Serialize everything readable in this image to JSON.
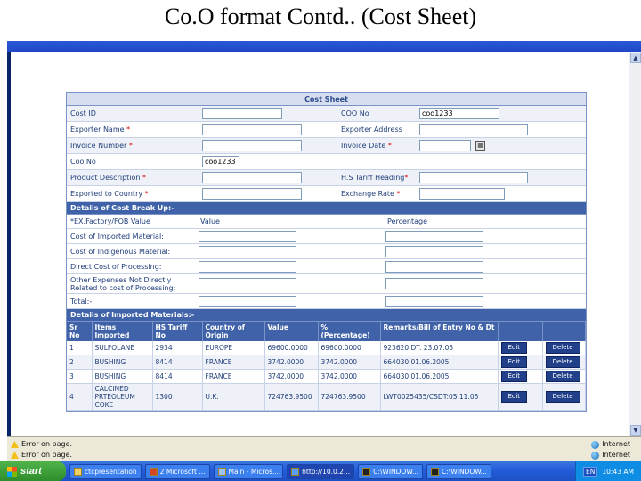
{
  "slide_title": "Co.O format Contd.. (Cost Sheet)",
  "browser": {
    "window_title": "",
    "status_left": "Error on page.",
    "status_zone": "Internet"
  },
  "form": {
    "title": "Cost Sheet",
    "fields": {
      "cost_id": {
        "label": "Cost ID",
        "required": false,
        "value": ""
      },
      "coo_no": {
        "label": "COO No",
        "required": false,
        "value": "coo1233"
      },
      "exporter_name": {
        "label": "Exporter Name",
        "required": true,
        "value": ""
      },
      "exporter_address": {
        "label": "Exporter Address",
        "required": false,
        "value": ""
      },
      "invoice_number": {
        "label": "Invoice Number",
        "required": true,
        "value": ""
      },
      "invoice_date": {
        "label": "Invoice Date",
        "required": true,
        "value": ""
      },
      "coo_no2": {
        "label": "Coo No",
        "required": false,
        "value": "coo1233"
      },
      "product_description": {
        "label": "Product Description",
        "required": true,
        "value": ""
      },
      "hs_tariff_heading": {
        "label": "H.S Tariff Heading",
        "required": true,
        "value": ""
      },
      "exported_to_country": {
        "label": "Exported to Country",
        "required": true,
        "value": ""
      },
      "exchange_rate": {
        "label": "Exchange Rate",
        "required": true,
        "value": ""
      }
    },
    "required_mark": "*",
    "cost_breakup": {
      "section_title": "Details of Cost Break Up:-",
      "col_item": "*EX.Factory/FOB Value",
      "col_value": "Value",
      "col_percentage": "Percentage",
      "rows": [
        {
          "label": "Cost of Imported Material:"
        },
        {
          "label": "Cost of Indigenous Material:"
        },
        {
          "label": "Direct Cost of Processing:"
        },
        {
          "label": "Other Expenses Not Directly Related to cost of Processing:"
        },
        {
          "label": "Total:-"
        }
      ]
    },
    "imported": {
      "section_title": "Details of Imported Materials:-",
      "columns": [
        "Sr No",
        "Items Imported",
        "HS Tariff No",
        "Country of Origin",
        "Value",
        "% (Percentage)",
        "Remarks/Bill of Entry No & Dt",
        "",
        ""
      ],
      "rows": [
        {
          "sr": "1",
          "item": "SULFOLANE",
          "hs": "2934",
          "country": "EUROPE",
          "value": "69600.0000",
          "pct": "69600.0000",
          "remarks": "923620 DT. 23.07.05"
        },
        {
          "sr": "2",
          "item": "BUSHING",
          "hs": "8414",
          "country": "FRANCE",
          "value": "3742.0000",
          "pct": "3742.0000",
          "remarks": "664030 01.06.2005"
        },
        {
          "sr": "3",
          "item": "BUSHING",
          "hs": "8414",
          "country": "FRANCE",
          "value": "3742.0000",
          "pct": "3742.0000",
          "remarks": "664030 01.06.2005"
        },
        {
          "sr": "4",
          "item": "CALCINED PRTEOLEUM COKE",
          "hs": "1300",
          "country": "U.K.",
          "value": "724763.9500",
          "pct": "724763.9500",
          "remarks": "LWT0025435/CSDT:05.11.05"
        }
      ],
      "edit_label": "Edit",
      "delete_label": "Delete"
    }
  },
  "taskbar": {
    "start_label": "start",
    "tasks": [
      {
        "label": "ctcpresentation",
        "active": false
      },
      {
        "label": "2 Microsoft ...",
        "active": false
      },
      {
        "label": "Main - Micros...",
        "active": false
      },
      {
        "label": "http://10.0.2...",
        "active": true
      },
      {
        "label": "C:\\WINDOW...",
        "active": false
      },
      {
        "label": "C:\\WINDOW...",
        "active": false
      }
    ],
    "lang": "EN",
    "time": "10:43 AM"
  },
  "colors": {
    "section_bg": "#3f62a8",
    "header_bg": "#d6deef",
    "label_text": "#1f3d7a",
    "required": "#dd0000"
  }
}
